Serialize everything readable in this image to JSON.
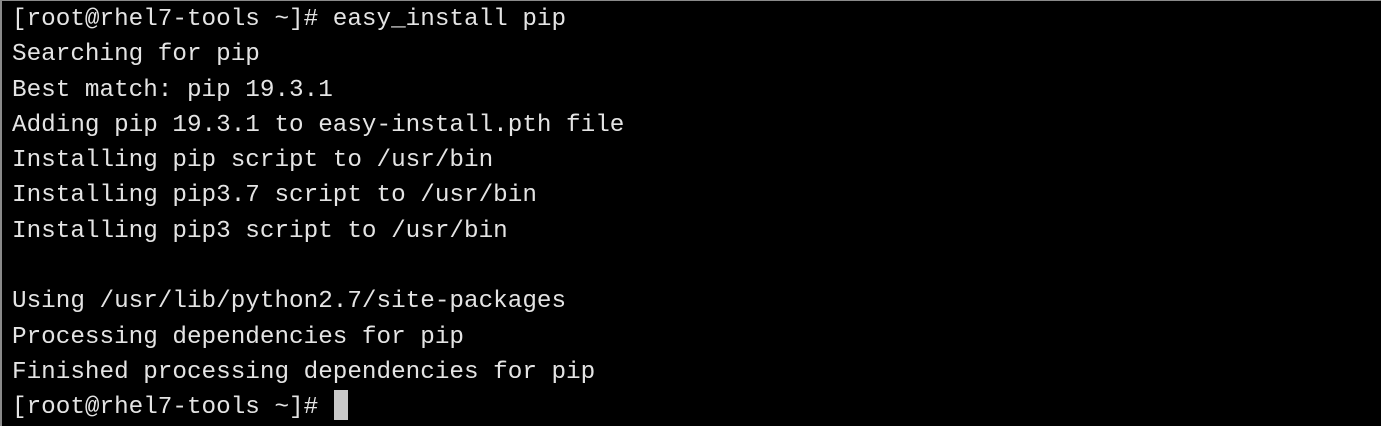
{
  "terminal": {
    "lines": [
      "[root@rhel7-tools ~]# easy_install pip",
      "Searching for pip",
      "Best match: pip 19.3.1",
      "Adding pip 19.3.1 to easy-install.pth file",
      "Installing pip script to /usr/bin",
      "Installing pip3.7 script to /usr/bin",
      "Installing pip3 script to /usr/bin",
      "",
      "Using /usr/lib/python2.7/site-packages",
      "Processing dependencies for pip",
      "Finished processing dependencies for pip"
    ],
    "prompt": "[root@rhel7-tools ~]# "
  }
}
